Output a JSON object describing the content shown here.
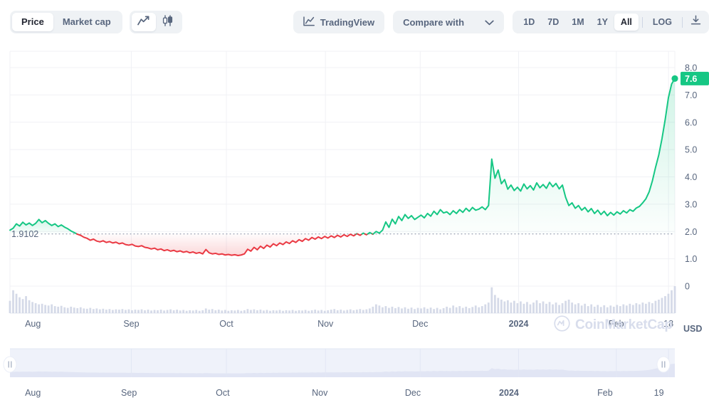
{
  "toolbar": {
    "metric_tabs": [
      {
        "label": "Price",
        "active": true
      },
      {
        "label": "Market cap",
        "active": false
      }
    ],
    "chart_type_buttons": [
      {
        "icon": "line-chart-icon",
        "active": true
      },
      {
        "icon": "candlestick-chart-icon",
        "active": false
      }
    ],
    "tradingview_label": "TradingView",
    "tradingview_icon": "tradingview-chart-icon",
    "compare_placeholder": "Compare with",
    "compare_value": "",
    "compare_caret_icon": "chevron-down-icon",
    "ranges": [
      {
        "label": "1D",
        "active": false
      },
      {
        "label": "7D",
        "active": false
      },
      {
        "label": "1M",
        "active": false
      },
      {
        "label": "1Y",
        "active": false
      },
      {
        "label": "All",
        "active": true
      }
    ],
    "log_label": "LOG",
    "log_active": false,
    "download_icon": "download-icon"
  },
  "colors": {
    "up": "#16c784",
    "down": "#ea3943",
    "axis_text": "#58667e",
    "grid": "#f0f1f5",
    "volume": "#ced4e4",
    "badge_bg": "#16c784",
    "toolbar_bg": "#eff2f5",
    "nav_band": "#eff2fa",
    "nav_area": "#dfe4f3"
  },
  "chart_data": {
    "type": "area",
    "title": "",
    "xlabel": "",
    "ylabel": "USD",
    "currency_label": "USD",
    "ylim": [
      0,
      8.2
    ],
    "grid": true,
    "legend": "none",
    "y_ticks": [
      "8.0",
      "7.0",
      "6.0",
      "5.0",
      "4.0",
      "3.0",
      "2.0",
      "1.0",
      "0"
    ],
    "y_tick_values": [
      8.0,
      7.0,
      6.0,
      5.0,
      4.0,
      3.0,
      2.0,
      1.0,
      0
    ],
    "x_ticks": [
      "Aug",
      "Sep",
      "Oct",
      "Nov",
      "Dec",
      "2024",
      "Feb",
      "18"
    ],
    "x_tick_bold": [
      false,
      false,
      false,
      false,
      false,
      true,
      false,
      false
    ],
    "reference_line": {
      "label": "1.9102",
      "value": 1.9102
    },
    "last_value_badge": {
      "label": "7.6",
      "value": 7.6
    },
    "series": [
      {
        "name": "Price",
        "unit": "USD",
        "values": [
          2.05,
          2.12,
          2.28,
          2.2,
          2.34,
          2.24,
          2.31,
          2.22,
          2.3,
          2.44,
          2.32,
          2.4,
          2.3,
          2.22,
          2.28,
          2.18,
          2.24,
          2.16,
          2.1,
          2.02,
          1.96,
          1.9,
          1.86,
          1.79,
          1.75,
          1.68,
          1.72,
          1.65,
          1.62,
          1.66,
          1.6,
          1.63,
          1.58,
          1.61,
          1.55,
          1.58,
          1.52,
          1.5,
          1.53,
          1.47,
          1.45,
          1.48,
          1.42,
          1.4,
          1.36,
          1.39,
          1.33,
          1.36,
          1.3,
          1.33,
          1.28,
          1.31,
          1.26,
          1.29,
          1.24,
          1.27,
          1.22,
          1.25,
          1.2,
          1.23,
          1.18,
          1.34,
          1.22,
          1.18,
          1.2,
          1.16,
          1.18,
          1.14,
          1.16,
          1.13,
          1.15,
          1.12,
          1.14,
          1.18,
          1.35,
          1.28,
          1.42,
          1.33,
          1.46,
          1.38,
          1.5,
          1.43,
          1.55,
          1.48,
          1.58,
          1.52,
          1.62,
          1.56,
          1.66,
          1.6,
          1.7,
          1.64,
          1.74,
          1.68,
          1.78,
          1.72,
          1.8,
          1.74,
          1.82,
          1.76,
          1.84,
          1.78,
          1.86,
          1.8,
          1.88,
          1.82,
          1.9,
          1.84,
          1.92,
          1.86,
          1.94,
          1.88,
          1.96,
          1.9,
          2.0,
          1.94,
          2.05,
          2.35,
          2.15,
          2.45,
          2.28,
          2.55,
          2.4,
          2.62,
          2.48,
          2.58,
          2.44,
          2.52,
          2.6,
          2.5,
          2.66,
          2.56,
          2.74,
          2.62,
          2.8,
          2.68,
          2.72,
          2.62,
          2.76,
          2.66,
          2.8,
          2.7,
          2.85,
          2.74,
          2.88,
          2.78,
          2.82,
          2.9,
          2.8,
          2.95,
          4.65,
          3.95,
          4.25,
          3.75,
          3.9,
          3.55,
          3.7,
          3.5,
          3.62,
          3.48,
          3.74,
          3.56,
          3.68,
          3.52,
          3.78,
          3.6,
          3.72,
          3.58,
          3.8,
          3.64,
          3.76,
          3.56,
          3.7,
          3.25,
          2.95,
          3.05,
          2.85,
          2.95,
          2.78,
          2.88,
          2.72,
          2.84,
          2.66,
          2.78,
          2.62,
          2.74,
          2.58,
          2.7,
          2.6,
          2.72,
          2.64,
          2.76,
          2.68,
          2.8,
          2.74,
          2.86,
          2.92,
          3.05,
          3.2,
          3.45,
          3.85,
          4.35,
          4.8,
          5.4,
          6.1,
          6.9,
          7.4,
          7.6
        ]
      }
    ],
    "volume_series": {
      "name": "Volume",
      "values": [
        0.42,
        0.78,
        0.66,
        0.54,
        0.48,
        0.58,
        0.44,
        0.38,
        0.34,
        0.3,
        0.32,
        0.28,
        0.26,
        0.3,
        0.24,
        0.22,
        0.25,
        0.2,
        0.18,
        0.22,
        0.19,
        0.17,
        0.2,
        0.16,
        0.15,
        0.18,
        0.14,
        0.16,
        0.13,
        0.15,
        0.12,
        0.14,
        0.11,
        0.13,
        0.12,
        0.14,
        0.11,
        0.13,
        0.1,
        0.12,
        0.11,
        0.13,
        0.1,
        0.12,
        0.09,
        0.11,
        0.1,
        0.12,
        0.09,
        0.11,
        0.13,
        0.1,
        0.12,
        0.09,
        0.11,
        0.08,
        0.1,
        0.09,
        0.11,
        0.08,
        0.1,
        0.16,
        0.12,
        0.14,
        0.1,
        0.12,
        0.09,
        0.11,
        0.08,
        0.1,
        0.09,
        0.11,
        0.08,
        0.1,
        0.14,
        0.11,
        0.13,
        0.1,
        0.12,
        0.09,
        0.11,
        0.08,
        0.1,
        0.09,
        0.11,
        0.08,
        0.1,
        0.09,
        0.11,
        0.08,
        0.1,
        0.09,
        0.11,
        0.08,
        0.1,
        0.12,
        0.09,
        0.11,
        0.08,
        0.1,
        0.12,
        0.14,
        0.1,
        0.12,
        0.09,
        0.11,
        0.13,
        0.1,
        0.12,
        0.14,
        0.11,
        0.13,
        0.16,
        0.22,
        0.3,
        0.26,
        0.2,
        0.24,
        0.18,
        0.22,
        0.17,
        0.21,
        0.16,
        0.2,
        0.15,
        0.19,
        0.14,
        0.18,
        0.16,
        0.2,
        0.15,
        0.19,
        0.14,
        0.18,
        0.13,
        0.17,
        0.22,
        0.18,
        0.26,
        0.2,
        0.24,
        0.18,
        0.22,
        0.17,
        0.21,
        0.26,
        0.2,
        0.24,
        0.3,
        0.36,
        0.88,
        0.62,
        0.52,
        0.46,
        0.4,
        0.44,
        0.36,
        0.42,
        0.34,
        0.4,
        0.32,
        0.38,
        0.3,
        0.36,
        0.44,
        0.34,
        0.4,
        0.32,
        0.38,
        0.3,
        0.36,
        0.28,
        0.34,
        0.42,
        0.46,
        0.36,
        0.3,
        0.34,
        0.26,
        0.32,
        0.24,
        0.3,
        0.22,
        0.28,
        0.21,
        0.27,
        0.2,
        0.26,
        0.22,
        0.28,
        0.24,
        0.3,
        0.26,
        0.32,
        0.28,
        0.34,
        0.3,
        0.36,
        0.32,
        0.38,
        0.34,
        0.42,
        0.46,
        0.52,
        0.58,
        0.66,
        0.78,
        0.92
      ]
    }
  },
  "navigator": {
    "x_ticks": [
      "Aug",
      "Sep",
      "Oct",
      "Nov",
      "Dec",
      "2024",
      "Feb",
      "19"
    ],
    "x_tick_bold": [
      false,
      false,
      false,
      false,
      false,
      true,
      false,
      false
    ],
    "handle_left_icon": "drag-handle-icon",
    "handle_right_icon": "drag-handle-icon",
    "selection_start_pct": 0,
    "selection_end_pct": 100
  },
  "watermark": {
    "text": "CoinMarketCap",
    "logo_icon": "coinmarketcap-logo-icon"
  }
}
